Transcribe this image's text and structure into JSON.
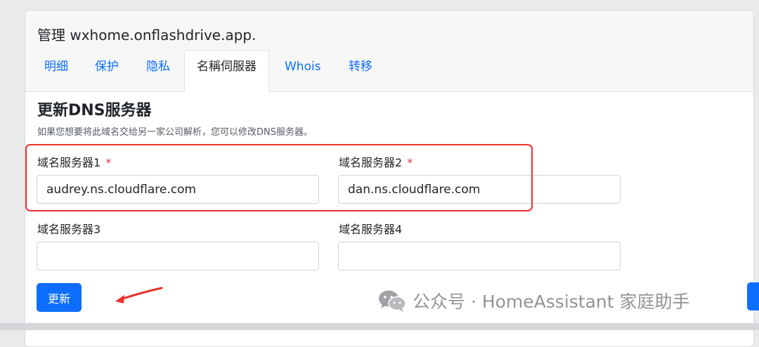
{
  "header": {
    "title": "管理 wxhome.onflashdrive.app."
  },
  "tabs": [
    {
      "label": "明细",
      "active": false
    },
    {
      "label": "保护",
      "active": false
    },
    {
      "label": "隐私",
      "active": false
    },
    {
      "label": "名稱伺服器",
      "active": true
    },
    {
      "label": "Whois",
      "active": false
    },
    {
      "label": "转移",
      "active": false
    }
  ],
  "section": {
    "title": "更新DNS服务器",
    "description": "如果您想要将此域名交给另一家公司解析，您可以修改DNS服务器。"
  },
  "fields": [
    {
      "label": "域名服务器1",
      "required": "*",
      "value": "audrey.ns.cloudflare.com"
    },
    {
      "label": "域名服务器2",
      "required": "*",
      "value": "dan.ns.cloudflare.com"
    },
    {
      "label": "域名服务器3",
      "value": ""
    },
    {
      "label": "域名服务器4",
      "value": ""
    }
  ],
  "actions": {
    "update_label": "更新"
  },
  "watermark": {
    "text": "公众号 · HomeAssistant 家庭助手"
  },
  "colors": {
    "accent": "#0d6efd",
    "highlight": "#e8322c",
    "required": "#dc3545"
  }
}
